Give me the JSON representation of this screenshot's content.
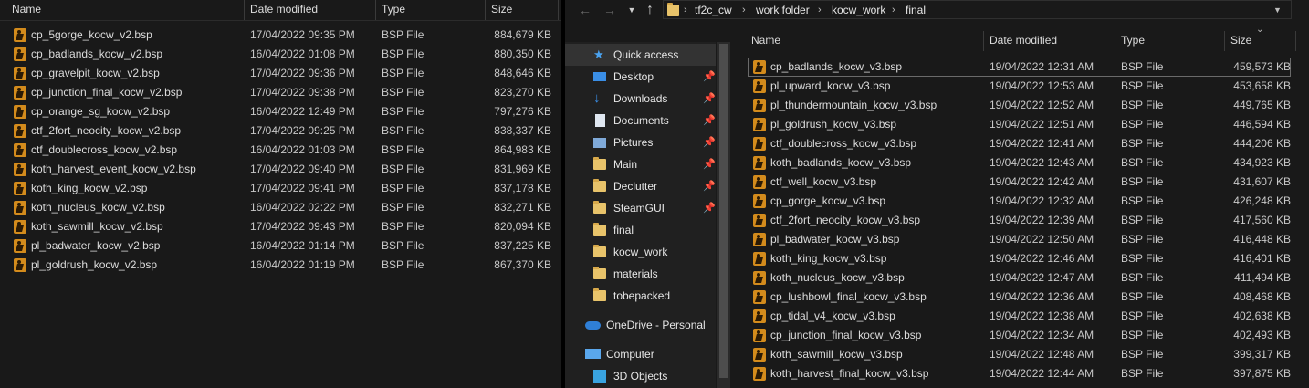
{
  "left_pane": {
    "columns": {
      "name": "Name",
      "date": "Date modified",
      "type": "Type",
      "size": "Size"
    },
    "files": [
      {
        "name": "cp_5gorge_kocw_v2.bsp",
        "date": "17/04/2022 09:35 PM",
        "type": "BSP File",
        "size": "884,679 KB"
      },
      {
        "name": "cp_badlands_kocw_v2.bsp",
        "date": "16/04/2022 01:08 PM",
        "type": "BSP File",
        "size": "880,350 KB"
      },
      {
        "name": "cp_gravelpit_kocw_v2.bsp",
        "date": "17/04/2022 09:36 PM",
        "type": "BSP File",
        "size": "848,646 KB"
      },
      {
        "name": "cp_junction_final_kocw_v2.bsp",
        "date": "17/04/2022 09:38 PM",
        "type": "BSP File",
        "size": "823,270 KB"
      },
      {
        "name": "cp_orange_sg_kocw_v2.bsp",
        "date": "16/04/2022 12:49 PM",
        "type": "BSP File",
        "size": "797,276 KB"
      },
      {
        "name": "ctf_2fort_neocity_kocw_v2.bsp",
        "date": "17/04/2022 09:25 PM",
        "type": "BSP File",
        "size": "838,337 KB"
      },
      {
        "name": "ctf_doublecross_kocw_v2.bsp",
        "date": "16/04/2022 01:03 PM",
        "type": "BSP File",
        "size": "864,983 KB"
      },
      {
        "name": "koth_harvest_event_kocw_v2.bsp",
        "date": "17/04/2022 09:40 PM",
        "type": "BSP File",
        "size": "831,969 KB"
      },
      {
        "name": "koth_king_kocw_v2.bsp",
        "date": "17/04/2022 09:41 PM",
        "type": "BSP File",
        "size": "837,178 KB"
      },
      {
        "name": "koth_nucleus_kocw_v2.bsp",
        "date": "16/04/2022 02:22 PM",
        "type": "BSP File",
        "size": "832,271 KB"
      },
      {
        "name": "koth_sawmill_kocw_v2.bsp",
        "date": "17/04/2022 09:43 PM",
        "type": "BSP File",
        "size": "820,094 KB"
      },
      {
        "name": "pl_badwater_kocw_v2.bsp",
        "date": "16/04/2022 01:14 PM",
        "type": "BSP File",
        "size": "837,225 KB"
      },
      {
        "name": "pl_goldrush_kocw_v2.bsp",
        "date": "16/04/2022 01:19 PM",
        "type": "BSP File",
        "size": "867,370 KB"
      }
    ]
  },
  "right_window": {
    "breadcrumb": [
      "tf2c_cw",
      "work folder",
      "kocw_work",
      "final"
    ],
    "nav_icons": {
      "back": "arrow-left-icon",
      "forward": "arrow-right-icon",
      "recent": "chevron-down-icon",
      "up": "arrow-up-icon"
    },
    "nav_pane": [
      {
        "label": "Quick access",
        "icon": "star-icon",
        "pinned": false
      },
      {
        "label": "Desktop",
        "icon": "desktop-icon",
        "pinned": true
      },
      {
        "label": "Downloads",
        "icon": "download-icon",
        "pinned": true
      },
      {
        "label": "Documents",
        "icon": "document-icon",
        "pinned": true
      },
      {
        "label": "Pictures",
        "icon": "pictures-icon",
        "pinned": true
      },
      {
        "label": "Main",
        "icon": "folder-icon",
        "pinned": true
      },
      {
        "label": "Declutter",
        "icon": "folder-icon",
        "pinned": true
      },
      {
        "label": "SteamGUI",
        "icon": "folder-icon",
        "pinned": true
      },
      {
        "label": "final",
        "icon": "folder-icon",
        "pinned": false
      },
      {
        "label": "kocw_work",
        "icon": "folder-icon",
        "pinned": false
      },
      {
        "label": "materials",
        "icon": "folder-icon",
        "pinned": false
      },
      {
        "label": "tobepacked",
        "icon": "folder-icon",
        "pinned": false
      },
      {
        "label": "OneDrive - Personal",
        "icon": "cloud-icon",
        "pinned": false
      },
      {
        "label": "Computer",
        "icon": "computer-icon",
        "pinned": false
      },
      {
        "label": "3D Objects",
        "icon": "cube-icon",
        "pinned": false
      }
    ],
    "columns": {
      "name": "Name",
      "date": "Date modified",
      "type": "Type",
      "size": "Size"
    },
    "files": [
      {
        "name": "cp_badlands_kocw_v3.bsp",
        "date": "19/04/2022 12:31 AM",
        "type": "BSP File",
        "size": "459,573 KB"
      },
      {
        "name": "pl_upward_kocw_v3.bsp",
        "date": "19/04/2022 12:53 AM",
        "type": "BSP File",
        "size": "453,658 KB"
      },
      {
        "name": "pl_thundermountain_kocw_v3.bsp",
        "date": "19/04/2022 12:52 AM",
        "type": "BSP File",
        "size": "449,765 KB"
      },
      {
        "name": "pl_goldrush_kocw_v3.bsp",
        "date": "19/04/2022 12:51 AM",
        "type": "BSP File",
        "size": "446,594 KB"
      },
      {
        "name": "ctf_doublecross_kocw_v3.bsp",
        "date": "19/04/2022 12:41 AM",
        "type": "BSP File",
        "size": "444,206 KB"
      },
      {
        "name": "koth_badlands_kocw_v3.bsp",
        "date": "19/04/2022 12:43 AM",
        "type": "BSP File",
        "size": "434,923 KB"
      },
      {
        "name": "ctf_well_kocw_v3.bsp",
        "date": "19/04/2022 12:42 AM",
        "type": "BSP File",
        "size": "431,607 KB"
      },
      {
        "name": "cp_gorge_kocw_v3.bsp",
        "date": "19/04/2022 12:32 AM",
        "type": "BSP File",
        "size": "426,248 KB"
      },
      {
        "name": "ctf_2fort_neocity_kocw_v3.bsp",
        "date": "19/04/2022 12:39 AM",
        "type": "BSP File",
        "size": "417,560 KB"
      },
      {
        "name": "pl_badwater_kocw_v3.bsp",
        "date": "19/04/2022 12:50 AM",
        "type": "BSP File",
        "size": "416,448 KB"
      },
      {
        "name": "koth_king_kocw_v3.bsp",
        "date": "19/04/2022 12:46 AM",
        "type": "BSP File",
        "size": "416,401 KB"
      },
      {
        "name": "koth_nucleus_kocw_v3.bsp",
        "date": "19/04/2022 12:47 AM",
        "type": "BSP File",
        "size": "411,494 KB"
      },
      {
        "name": "cp_lushbowl_final_kocw_v3.bsp",
        "date": "19/04/2022 12:36 AM",
        "type": "BSP File",
        "size": "408,468 KB"
      },
      {
        "name": "cp_tidal_v4_kocw_v3.bsp",
        "date": "19/04/2022 12:38 AM",
        "type": "BSP File",
        "size": "402,638 KB"
      },
      {
        "name": "cp_junction_final_kocw_v3.bsp",
        "date": "19/04/2022 12:34 AM",
        "type": "BSP File",
        "size": "402,493 KB"
      },
      {
        "name": "koth_sawmill_kocw_v3.bsp",
        "date": "19/04/2022 12:48 AM",
        "type": "BSP File",
        "size": "399,317 KB"
      },
      {
        "name": "koth_harvest_final_kocw_v3.bsp",
        "date": "19/04/2022 12:44 AM",
        "type": "BSP File",
        "size": "397,875 KB"
      }
    ]
  }
}
